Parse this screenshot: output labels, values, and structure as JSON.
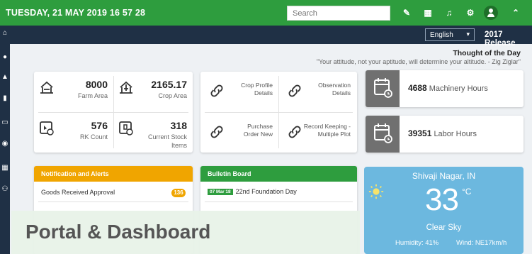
{
  "header": {
    "datetime": "TUESDAY, 21 MAY 2019  16  57  28",
    "search_placeholder": "Search",
    "icons": [
      "edit-icon",
      "grid-icon",
      "headset-icon",
      "gear-icon",
      "user-icon",
      "chevron-up-icon"
    ]
  },
  "subbar": {
    "language": "English",
    "release": "2017 Release"
  },
  "sidebar": {
    "icons": [
      "home-icon",
      "user-icon",
      "farm-icon",
      "chart-icon",
      "monitor-icon",
      "tractor-icon",
      "table-icon",
      "people-icon"
    ]
  },
  "quote": {
    "title": "Thought of the Day",
    "text": "\"Your attitude, not your aptitude, will determine your altitude. - Zig Ziglar\""
  },
  "stats": {
    "farm_area": {
      "value": "8000",
      "label": "Farm Area"
    },
    "crop_area": {
      "value": "2165.17",
      "label": "Crop Area"
    },
    "rk_count": {
      "value": "576",
      "label": "RK Count"
    },
    "stock_items": {
      "value": "318",
      "label": "Current Stock Items"
    }
  },
  "links": {
    "crop_profile": "Crop Profile Details",
    "observation": "Observation Details",
    "purchase_order": "Purchase Order New",
    "record_keeping": "Record Keeping - Multiple Plot"
  },
  "hours": {
    "machinery": {
      "value": "4688",
      "label": "Machinery Hours"
    },
    "labor": {
      "value": "39351",
      "label": "Labor Hours"
    }
  },
  "notifications": {
    "title": "Notification and Alerts",
    "items": [
      {
        "label": "Goods Received Approval",
        "count": "136"
      }
    ]
  },
  "bulletin": {
    "title": "Bulletin Board",
    "items": [
      {
        "date": "07 Mar 18",
        "text": "22nd Foundation Day"
      }
    ]
  },
  "weather": {
    "city": "Shivaji Nagar, IN",
    "temp": "33",
    "unit": "°C",
    "condition": "Clear Sky",
    "humidity": "Humidity: 41%",
    "wind": "Wind: NE17km/h"
  },
  "banner": {
    "text": "Portal & Dashboard"
  },
  "colors": {
    "primary_green": "#2e9d3e",
    "dark_navy": "#1f3045",
    "alert_orange": "#f0a500",
    "weather_blue": "#6cb8df"
  }
}
